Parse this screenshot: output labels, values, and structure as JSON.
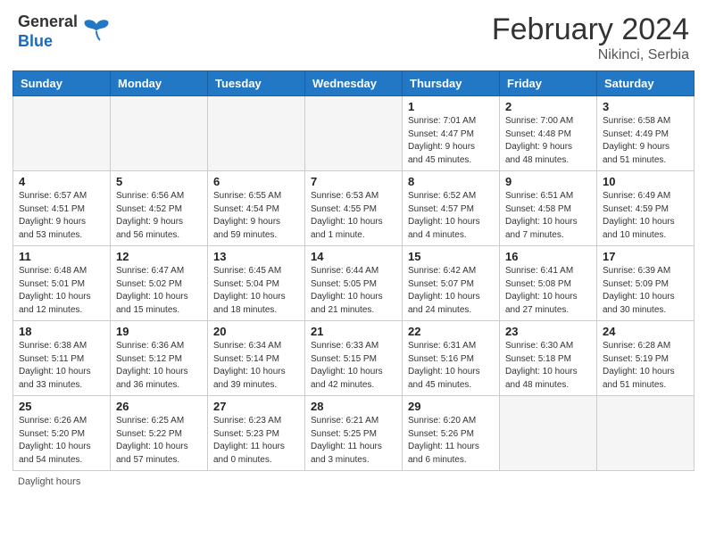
{
  "header": {
    "logo_general": "General",
    "logo_blue": "Blue",
    "month_year": "February 2024",
    "location": "Nikinci, Serbia"
  },
  "days_of_week": [
    "Sunday",
    "Monday",
    "Tuesday",
    "Wednesday",
    "Thursday",
    "Friday",
    "Saturday"
  ],
  "weeks": [
    [
      {
        "num": "",
        "info": ""
      },
      {
        "num": "",
        "info": ""
      },
      {
        "num": "",
        "info": ""
      },
      {
        "num": "",
        "info": ""
      },
      {
        "num": "1",
        "info": "Sunrise: 7:01 AM\nSunset: 4:47 PM\nDaylight: 9 hours\nand 45 minutes."
      },
      {
        "num": "2",
        "info": "Sunrise: 7:00 AM\nSunset: 4:48 PM\nDaylight: 9 hours\nand 48 minutes."
      },
      {
        "num": "3",
        "info": "Sunrise: 6:58 AM\nSunset: 4:49 PM\nDaylight: 9 hours\nand 51 minutes."
      }
    ],
    [
      {
        "num": "4",
        "info": "Sunrise: 6:57 AM\nSunset: 4:51 PM\nDaylight: 9 hours\nand 53 minutes."
      },
      {
        "num": "5",
        "info": "Sunrise: 6:56 AM\nSunset: 4:52 PM\nDaylight: 9 hours\nand 56 minutes."
      },
      {
        "num": "6",
        "info": "Sunrise: 6:55 AM\nSunset: 4:54 PM\nDaylight: 9 hours\nand 59 minutes."
      },
      {
        "num": "7",
        "info": "Sunrise: 6:53 AM\nSunset: 4:55 PM\nDaylight: 10 hours\nand 1 minute."
      },
      {
        "num": "8",
        "info": "Sunrise: 6:52 AM\nSunset: 4:57 PM\nDaylight: 10 hours\nand 4 minutes."
      },
      {
        "num": "9",
        "info": "Sunrise: 6:51 AM\nSunset: 4:58 PM\nDaylight: 10 hours\nand 7 minutes."
      },
      {
        "num": "10",
        "info": "Sunrise: 6:49 AM\nSunset: 4:59 PM\nDaylight: 10 hours\nand 10 minutes."
      }
    ],
    [
      {
        "num": "11",
        "info": "Sunrise: 6:48 AM\nSunset: 5:01 PM\nDaylight: 10 hours\nand 12 minutes."
      },
      {
        "num": "12",
        "info": "Sunrise: 6:47 AM\nSunset: 5:02 PM\nDaylight: 10 hours\nand 15 minutes."
      },
      {
        "num": "13",
        "info": "Sunrise: 6:45 AM\nSunset: 5:04 PM\nDaylight: 10 hours\nand 18 minutes."
      },
      {
        "num": "14",
        "info": "Sunrise: 6:44 AM\nSunset: 5:05 PM\nDaylight: 10 hours\nand 21 minutes."
      },
      {
        "num": "15",
        "info": "Sunrise: 6:42 AM\nSunset: 5:07 PM\nDaylight: 10 hours\nand 24 minutes."
      },
      {
        "num": "16",
        "info": "Sunrise: 6:41 AM\nSunset: 5:08 PM\nDaylight: 10 hours\nand 27 minutes."
      },
      {
        "num": "17",
        "info": "Sunrise: 6:39 AM\nSunset: 5:09 PM\nDaylight: 10 hours\nand 30 minutes."
      }
    ],
    [
      {
        "num": "18",
        "info": "Sunrise: 6:38 AM\nSunset: 5:11 PM\nDaylight: 10 hours\nand 33 minutes."
      },
      {
        "num": "19",
        "info": "Sunrise: 6:36 AM\nSunset: 5:12 PM\nDaylight: 10 hours\nand 36 minutes."
      },
      {
        "num": "20",
        "info": "Sunrise: 6:34 AM\nSunset: 5:14 PM\nDaylight: 10 hours\nand 39 minutes."
      },
      {
        "num": "21",
        "info": "Sunrise: 6:33 AM\nSunset: 5:15 PM\nDaylight: 10 hours\nand 42 minutes."
      },
      {
        "num": "22",
        "info": "Sunrise: 6:31 AM\nSunset: 5:16 PM\nDaylight: 10 hours\nand 45 minutes."
      },
      {
        "num": "23",
        "info": "Sunrise: 6:30 AM\nSunset: 5:18 PM\nDaylight: 10 hours\nand 48 minutes."
      },
      {
        "num": "24",
        "info": "Sunrise: 6:28 AM\nSunset: 5:19 PM\nDaylight: 10 hours\nand 51 minutes."
      }
    ],
    [
      {
        "num": "25",
        "info": "Sunrise: 6:26 AM\nSunset: 5:20 PM\nDaylight: 10 hours\nand 54 minutes."
      },
      {
        "num": "26",
        "info": "Sunrise: 6:25 AM\nSunset: 5:22 PM\nDaylight: 10 hours\nand 57 minutes."
      },
      {
        "num": "27",
        "info": "Sunrise: 6:23 AM\nSunset: 5:23 PM\nDaylight: 11 hours\nand 0 minutes."
      },
      {
        "num": "28",
        "info": "Sunrise: 6:21 AM\nSunset: 5:25 PM\nDaylight: 11 hours\nand 3 minutes."
      },
      {
        "num": "29",
        "info": "Sunrise: 6:20 AM\nSunset: 5:26 PM\nDaylight: 11 hours\nand 6 minutes."
      },
      {
        "num": "",
        "info": ""
      },
      {
        "num": "",
        "info": ""
      }
    ]
  ],
  "footer": {
    "daylight_hours": "Daylight hours"
  }
}
